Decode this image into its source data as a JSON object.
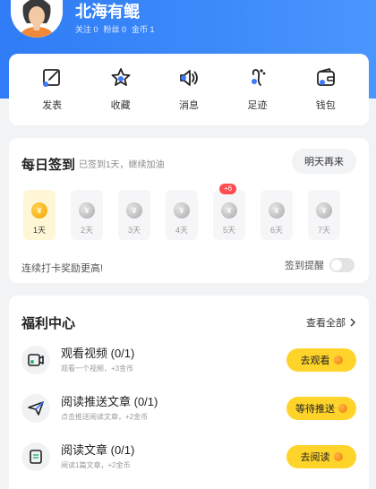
{
  "profile": {
    "username": "北海有鲲",
    "following": "关注 0",
    "fans": "粉丝 0",
    "coins": "金币 1"
  },
  "quick_actions": [
    {
      "label": "发表",
      "icon": "edit-icon"
    },
    {
      "label": "收藏",
      "icon": "star-icon"
    },
    {
      "label": "消息",
      "icon": "speaker-icon"
    },
    {
      "label": "足迹",
      "icon": "footprint-icon"
    },
    {
      "label": "钱包",
      "icon": "wallet-icon"
    }
  ],
  "checkin": {
    "title": "每日签到",
    "subtitle": "已签到1天，继续加油",
    "tomorrow_button": "明天再来",
    "days": [
      {
        "label": "1天",
        "active": true,
        "bonus": ""
      },
      {
        "label": "2天",
        "active": false,
        "bonus": ""
      },
      {
        "label": "3天",
        "active": false,
        "bonus": ""
      },
      {
        "label": "4天",
        "active": false,
        "bonus": ""
      },
      {
        "label": "5天",
        "active": false,
        "bonus": "+6"
      },
      {
        "label": "6天",
        "active": false,
        "bonus": ""
      },
      {
        "label": "7天",
        "active": false,
        "bonus": ""
      }
    ],
    "streak_text": "连续打卡奖励更高!",
    "remind_label": "签到提醒",
    "remind_on": false
  },
  "welfare": {
    "title": "福利中心",
    "view_all": "查看全部",
    "tasks": [
      {
        "title": "观看视频 (0/1)",
        "desc": "观看一个视频，+3金币",
        "button": "去观看",
        "icon": "video-icon"
      },
      {
        "title": "阅读推送文章 (0/1)",
        "desc": "点击推送阅读文章，+2金币",
        "button": "等待推送",
        "icon": "send-icon"
      },
      {
        "title": "阅读文章 (0/1)",
        "desc": "阅读1篇文章，+2金币",
        "button": "去阅读",
        "icon": "article-icon"
      }
    ]
  },
  "colors": {
    "header_blue": "#2f7cf6",
    "button_yellow": "#ffd42a",
    "bonus_red": "#ff4d4f"
  }
}
